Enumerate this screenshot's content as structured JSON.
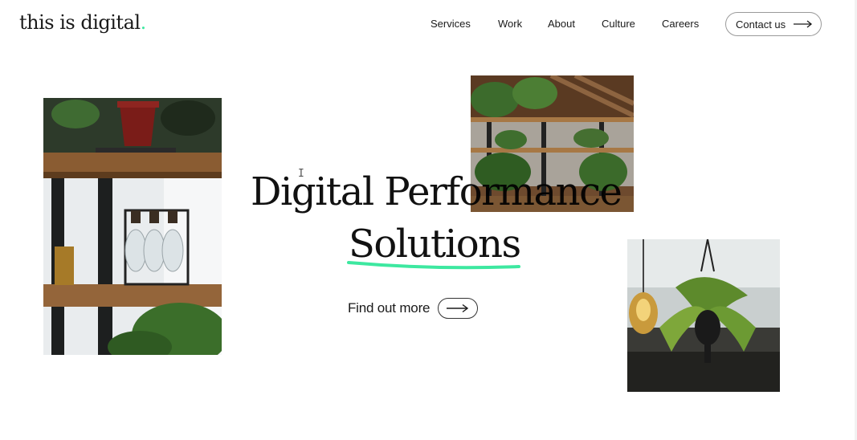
{
  "header": {
    "logo_text": "this is digital",
    "logo_dot": ".",
    "nav": [
      "Services",
      "Work",
      "About",
      "Culture",
      "Careers"
    ],
    "contact_label": "Contact us"
  },
  "hero": {
    "line1": "Digital Performance",
    "line2": "Solutions",
    "cta_label": "Find out more"
  },
  "colors": {
    "accent": "#3de8a0",
    "text": "#1a1a1a",
    "background": "#ffffff"
  },
  "icons": {
    "contact_arrow": "arrow-right-icon",
    "cta_arrow": "arrow-right-icon",
    "cursor": "text-cursor-icon"
  },
  "images": [
    "shelf-with-plants-and-bottles",
    "office-with-plant-shelves",
    "hanging-bulb-and-plant"
  ]
}
